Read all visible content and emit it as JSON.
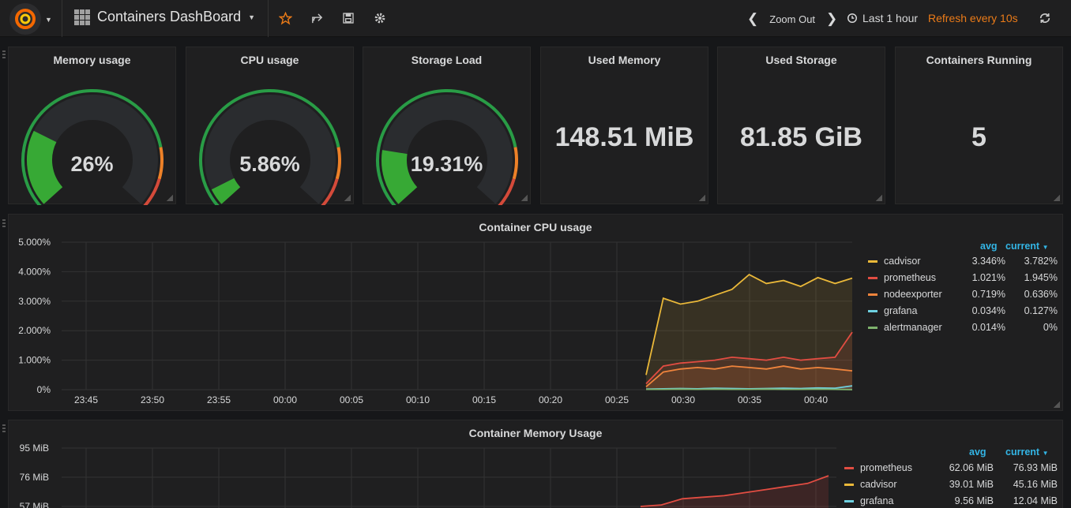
{
  "navbar": {
    "title": "Containers DashBoard",
    "zoom_label": "Zoom Out",
    "time_range": "Last 1 hour",
    "refresh": "Refresh every 10s"
  },
  "gauges": [
    {
      "title": "Memory usage",
      "value": "26%",
      "fraction": 0.26
    },
    {
      "title": "CPU usage",
      "value": "5.86%",
      "fraction": 0.0586
    },
    {
      "title": "Storage Load",
      "value": "19.31%",
      "fraction": 0.1931
    }
  ],
  "stats": [
    {
      "title": "Used Memory",
      "value": "148.51 MiB"
    },
    {
      "title": "Used Storage",
      "value": "81.85 GiB"
    },
    {
      "title": "Containers Running",
      "value": "5"
    }
  ],
  "cpu_panel": {
    "title": "Container CPU usage",
    "legend_avg": "avg",
    "legend_current": "current",
    "series": [
      {
        "name": "cadvisor",
        "avg": "3.346%",
        "current": "3.782%",
        "color": "#eab839"
      },
      {
        "name": "prometheus",
        "avg": "1.021%",
        "current": "1.945%",
        "color": "#e24d42"
      },
      {
        "name": "nodeexporter",
        "avg": "0.719%",
        "current": "0.636%",
        "color": "#ef843c"
      },
      {
        "name": "grafana",
        "avg": "0.034%",
        "current": "0.127%",
        "color": "#6ed0e0"
      },
      {
        "name": "alertmanager",
        "avg": "0.014%",
        "current": "0%",
        "color": "#7eb26d"
      }
    ]
  },
  "mem_panel": {
    "title": "Container Memory Usage",
    "legend_avg": "avg",
    "legend_current": "current",
    "series": [
      {
        "name": "prometheus",
        "avg": "62.06 MiB",
        "current": "76.93 MiB",
        "color": "#e24d42"
      },
      {
        "name": "cadvisor",
        "avg": "39.01 MiB",
        "current": "45.16 MiB",
        "color": "#eab839"
      },
      {
        "name": "grafana",
        "avg": "9.56 MiB",
        "current": "12.04 MiB",
        "color": "#6ed0e0"
      }
    ]
  },
  "chart_data": [
    {
      "type": "line",
      "title": "Container CPU usage",
      "x": [
        "23:45",
        "23:50",
        "23:55",
        "00:00",
        "00:05",
        "00:10",
        "00:15",
        "00:20",
        "00:25",
        "00:30",
        "00:35",
        "00:40"
      ],
      "yticks": [
        "5.000%",
        "4.000%",
        "3.000%",
        "2.000%",
        "1.000%",
        "0%"
      ],
      "ylim": [
        0,
        5
      ],
      "series": [
        {
          "name": "cadvisor",
          "values": [
            0.5,
            3.1,
            2.9,
            3.0,
            3.2,
            3.4,
            3.9,
            3.6,
            3.7,
            3.5,
            3.8,
            3.6,
            3.78
          ]
        },
        {
          "name": "prometheus",
          "values": [
            0.2,
            0.8,
            0.9,
            0.95,
            1.0,
            1.1,
            1.05,
            1.0,
            1.1,
            1.0,
            1.05,
            1.1,
            1.95
          ]
        },
        {
          "name": "nodeexporter",
          "values": [
            0.1,
            0.6,
            0.7,
            0.75,
            0.7,
            0.8,
            0.75,
            0.7,
            0.8,
            0.7,
            0.75,
            0.7,
            0.64
          ]
        },
        {
          "name": "grafana",
          "values": [
            0.02,
            0.03,
            0.04,
            0.03,
            0.05,
            0.04,
            0.03,
            0.04,
            0.05,
            0.04,
            0.06,
            0.05,
            0.13
          ]
        },
        {
          "name": "alertmanager",
          "values": [
            0.01,
            0.01,
            0.02,
            0.01,
            0.02,
            0.01,
            0.01,
            0.02,
            0.01,
            0.01,
            0.02,
            0.01,
            0.0
          ]
        }
      ]
    },
    {
      "type": "line",
      "title": "Container Memory Usage",
      "yticks": [
        "95 MiB",
        "76 MiB",
        "57 MiB"
      ],
      "series": [
        {
          "name": "prometheus",
          "values": [
            57,
            58,
            62,
            63,
            64,
            66,
            68,
            70,
            72,
            77
          ]
        }
      ]
    }
  ]
}
